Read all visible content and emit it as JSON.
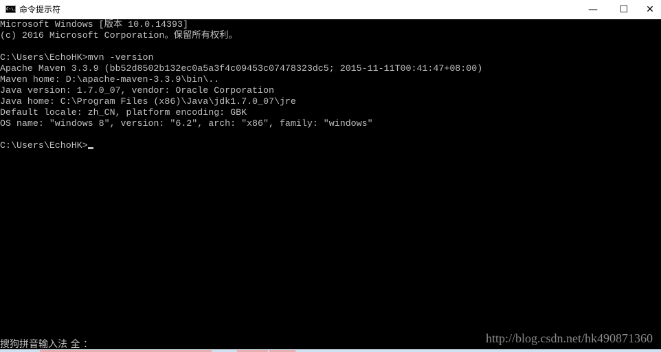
{
  "window": {
    "title": "命令提示符",
    "icon": "console-icon",
    "icon_text": "C:\\.",
    "minimize": "—",
    "maximize": "☐",
    "close": "✕"
  },
  "console": {
    "lines": [
      "Microsoft Windows [版本 10.0.14393]",
      "(c) 2016 Microsoft Corporation。保留所有权利。",
      "",
      "C:\\Users\\EchoHK>mvn -version",
      "Apache Maven 3.3.9 (bb52d8502b132ec0a5a3f4c09453c07478323dc5; 2015-11-11T00:41:47+08:00)",
      "Maven home: D:\\apache-maven-3.3.9\\bin\\..",
      "Java version: 1.7.0_07, vendor: Oracle Corporation",
      "Java home: C:\\Program Files (x86)\\Java\\jdk1.7.0_07\\jre",
      "Default locale: zh_CN, platform encoding: GBK",
      "OS name: \"windows 8\", version: \"6.2\", arch: \"x86\", family: \"windows\"",
      "",
      "C:\\Users\\EchoHK>"
    ],
    "ime_status": "搜狗拼音输入法 全 ："
  },
  "watermark": "http://blog.csdn.net/hk490871360",
  "colors": {
    "console_bg": "#000000",
    "console_fg": "#c0c0c0",
    "titlebar_bg": "#ffffff"
  }
}
